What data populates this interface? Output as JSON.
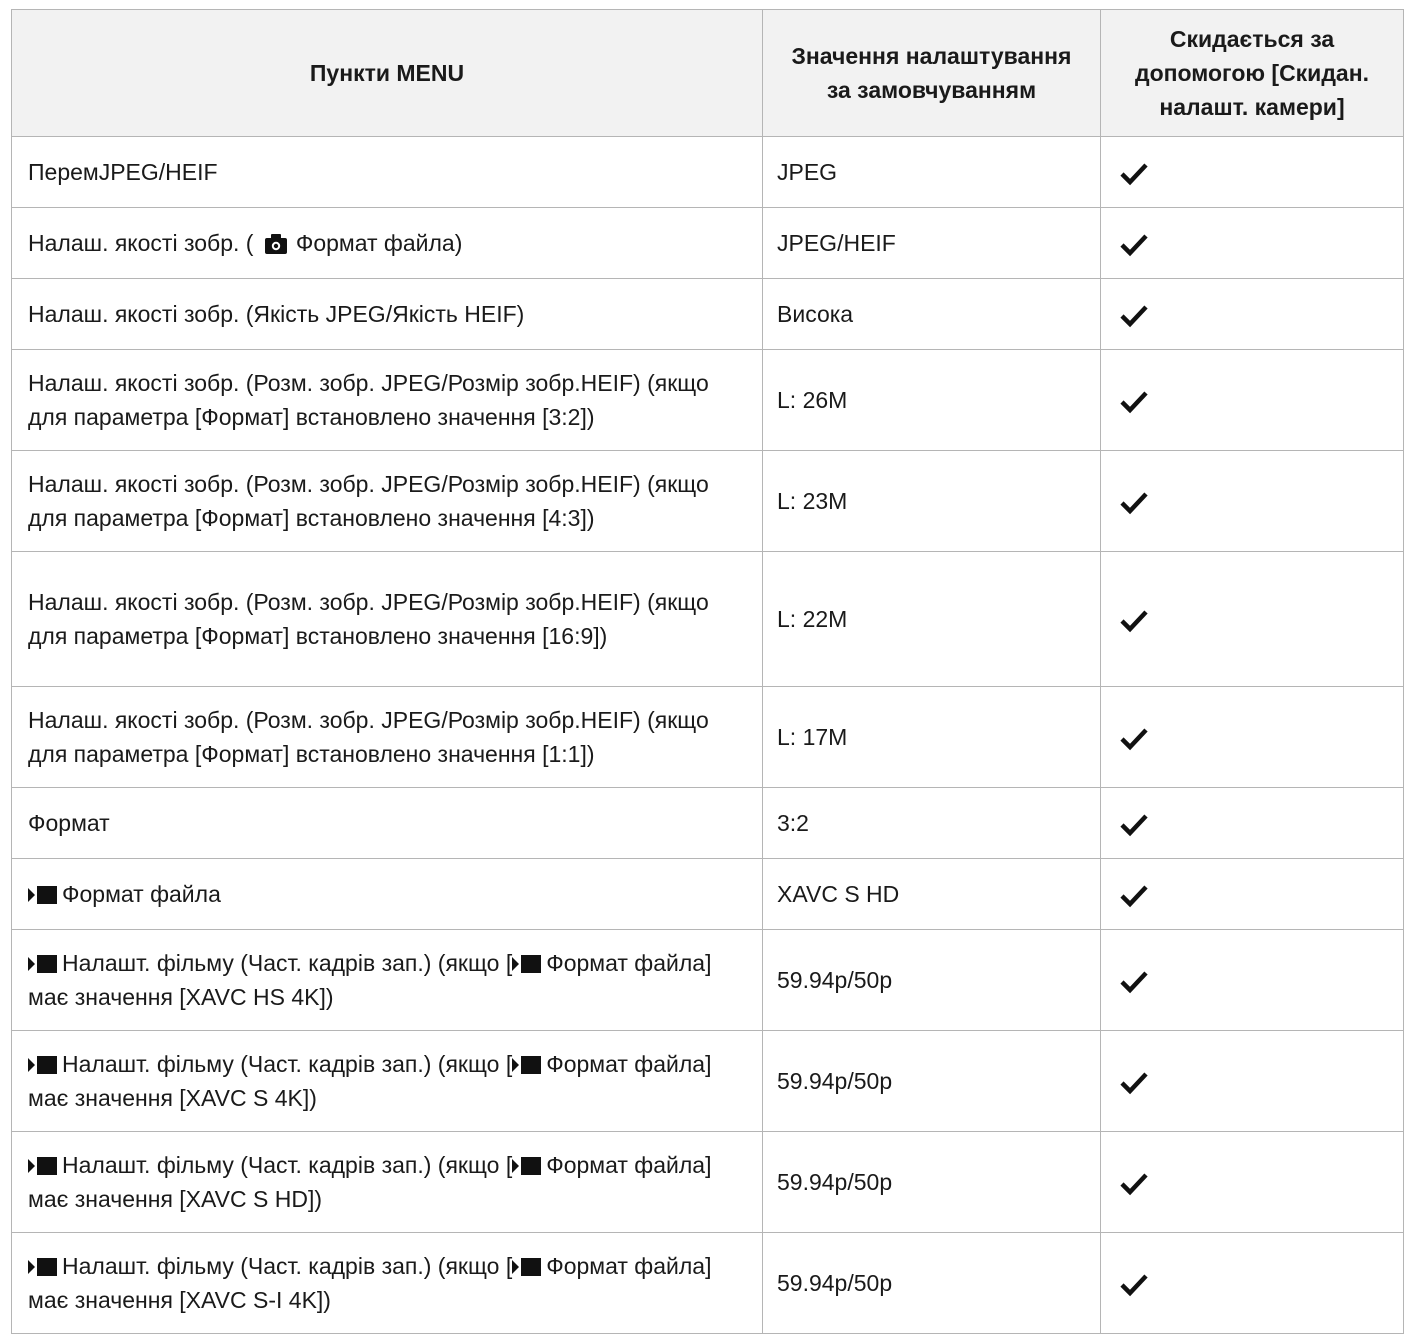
{
  "table": {
    "headers": {
      "menu_items": "Пункти MENU",
      "default_value": "Значення налаштування за замовчуванням",
      "reset_by": "Скидається за допомогою [Скидан. налашт. камери]"
    },
    "rows": [
      {
        "item": "ПеремJPEG/HEIF",
        "value": "JPEG",
        "reset": "check"
      },
      {
        "item_pre": "Налаш. якості зобр. (",
        "item_post": "Формат файла)",
        "item_icon": "camera-icon",
        "value": "JPEG/HEIF",
        "reset": "check"
      },
      {
        "item": "Налаш. якості зобр. (Якість JPEG/Якість HEIF)",
        "value": "Висока",
        "reset": "check"
      },
      {
        "item": "Налаш. якості зобр. (Розм. зобр. JPEG/Розмір зобр.HEIF) (якщо для параметра [Формат] встановлено значення [3:2])",
        "value": "L: 26M",
        "reset": "check"
      },
      {
        "item": "Налаш. якості зобр. (Розм. зобр. JPEG/Розмір зобр.HEIF) (якщо для параметра [Формат] встановлено значення [4:3])",
        "value": "L: 23M",
        "reset": "check"
      },
      {
        "item": "Налаш. якості зобр. (Розм. зобр. JPEG/Розмір зобр.HEIF) (якщо для параметра [Формат] встановлено значення [16:9])",
        "value": "L: 22M",
        "reset": "check"
      },
      {
        "item": "Налаш. якості зобр. (Розм. зобр. JPEG/Розмір зобр.HEIF) (якщо для параметра [Формат] встановлено значення [1:1])",
        "value": "L: 17M",
        "reset": "check"
      },
      {
        "item": "Формат",
        "value": "3:2",
        "reset": "check"
      },
      {
        "item": "Формат файла",
        "item_icon": "movie-icon",
        "value": "XAVC S HD",
        "reset": "check"
      },
      {
        "item_pre": "Налашт. фільму (Част. кадрів зап.) (якщо [",
        "item_post": "Формат файла] має значення [XAVC HS 4K])",
        "item_icon": "movie-icon",
        "value": "59.94p/50p",
        "reset": "check"
      },
      {
        "item_pre": "Налашт. фільму (Част. кадрів зап.) (якщо [",
        "item_post": "Формат файла] має значення [XAVC S 4K])",
        "item_icon": "movie-icon",
        "value": "59.94p/50p",
        "reset": "check"
      },
      {
        "item_pre": "Налашт. фільму (Част. кадрів зап.) (якщо [",
        "item_post": "Формат файла] має значення [XAVC S HD])",
        "item_icon": "movie-icon",
        "value": "59.94p/50p",
        "reset": "check"
      },
      {
        "item_pre": "Налашт. фільму (Част. кадрів зап.) (якщо [",
        "item_post": "Формат файла] має значення [XAVC S-I 4K])",
        "item_icon": "movie-icon",
        "value": "59.94p/50p",
        "reset": "check"
      }
    ]
  }
}
